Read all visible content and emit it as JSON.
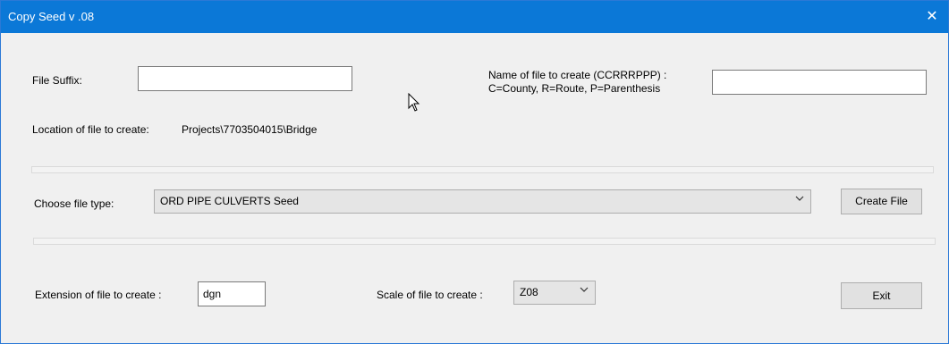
{
  "window": {
    "title": "Copy Seed v .08",
    "close_glyph": "✕"
  },
  "fields": {
    "file_suffix_label": "File Suffix:",
    "file_suffix_value": "",
    "name_label_line1": "Name of file to create (CCRRRPPP) :",
    "name_label_line2": "C=County, R=Route, P=Parenthesis",
    "name_value": "",
    "location_label": "Location of file to create:",
    "location_value": "Projects\\7703504015\\Bridge",
    "file_type_label": "Choose file type:",
    "file_type_value": "ORD PIPE CULVERTS Seed",
    "extension_label": "Extension of file to create :",
    "extension_value": "dgn",
    "scale_label": "Scale of file to create :",
    "scale_value": "Z08"
  },
  "buttons": {
    "create_file": "Create File",
    "exit": "Exit"
  },
  "icons": {
    "dropdown": "chevron-down-icon",
    "close": "close-icon",
    "cursor": "mouse-cursor-icon"
  }
}
